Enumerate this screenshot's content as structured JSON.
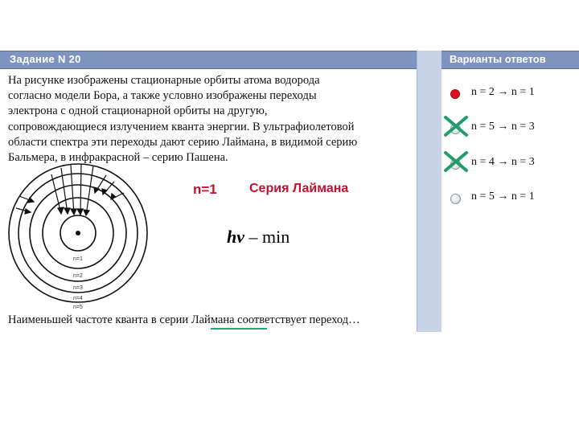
{
  "task": {
    "header": "Задание N 20",
    "lines": [
      "На рисунке изображены стационарные орбиты атома водорода",
      "согласно модели Бора, а также условно изображены переходы",
      "электрона с одной стационарной орбиты на другую,",
      "сопровождающиеся излучением кванта энергии. В ультрафиолетовой",
      "области спектра эти переходы дают серию Лаймана, в видимой    серию",
      "Бальмера, в инфракрасной – серию Пашена."
    ],
    "question": "Наименьшей частоте кванта в серии Лаймана соответствует переход…",
    "orbit_labels": [
      "n=1",
      "n=2",
      "n=3",
      "n=4",
      "n=5"
    ]
  },
  "annotations": {
    "level": "n=1",
    "series": "Серия Лаймана",
    "formula_symbol": "hν",
    "formula_rest": " – min"
  },
  "answers": {
    "header": "Варианты ответов",
    "options": [
      {
        "label": "n = 2 → n = 1",
        "state": "selected"
      },
      {
        "label": "n = 5 → n = 3",
        "state": "crossed"
      },
      {
        "label": "n = 4 → n = 3",
        "state": "crossed"
      },
      {
        "label": "n = 5 → n = 1",
        "state": "empty"
      }
    ]
  },
  "colors": {
    "header_bg": "#7f93bf",
    "scroll_bg": "#c9d3e8",
    "annotation": "#c8102e",
    "cross": "#1f9e6a",
    "selected_radio": "#d8102a"
  }
}
